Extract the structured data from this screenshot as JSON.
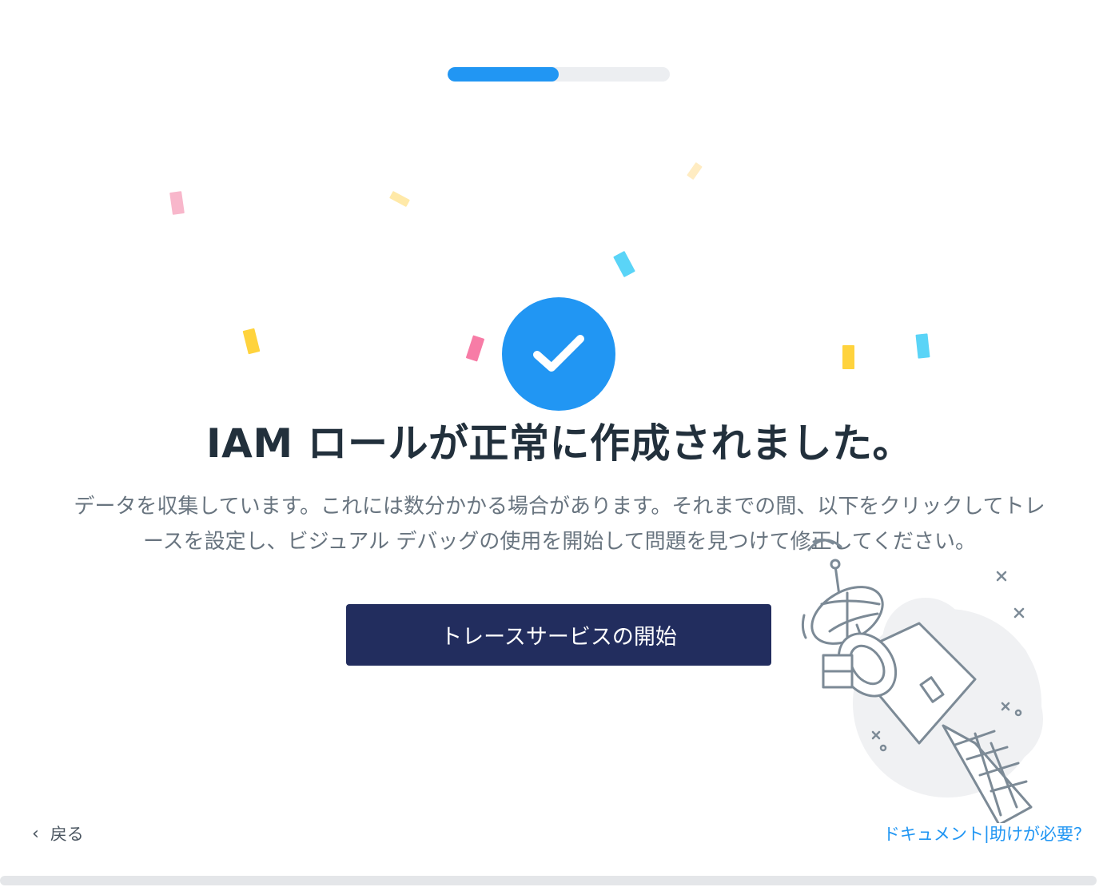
{
  "progress": {
    "value_fraction": 0.5
  },
  "status_icon": "checkmark-icon",
  "headline": "IAM ロールが正常に作成されました。",
  "description_line1": "データを収集しています。これには数分かかる場合があります。それまでの間、以下をクリックしてトレ",
  "description_line2": "ースを設定し、ビジュアル デバッグの使用を開始して問題を見つけて修正してください。",
  "primary_button": {
    "label": "トレースサービスの開始"
  },
  "footer": {
    "back_label": "戻る",
    "back_icon": "chevron-left-icon",
    "docs_label": "ドキュメント",
    "separator": "|",
    "help_label": "助けが必要？"
  },
  "colors": {
    "accent": "#2196f3",
    "primary_button_bg": "#222d5e",
    "headline": "#22303c",
    "body_text": "#68747f",
    "confetti": [
      "#f8b7cb",
      "#ffe9a8",
      "#ffecc2",
      "#5ad4f7",
      "#ffd33d",
      "#f77ca6"
    ]
  },
  "illustration": "satellite-illustration"
}
